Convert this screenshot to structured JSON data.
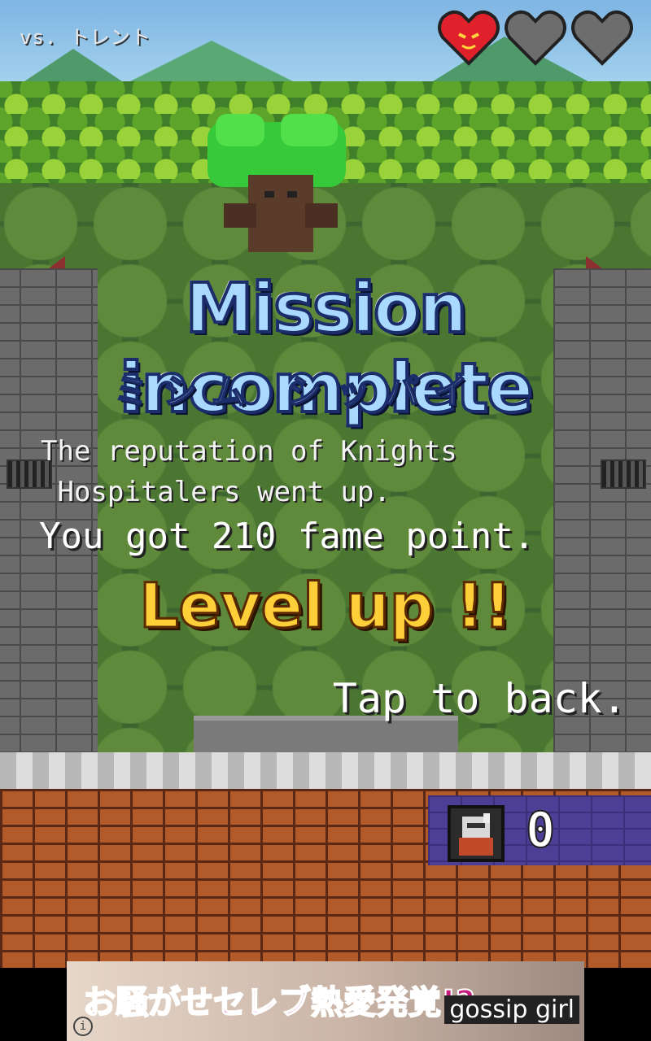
{
  "hud": {
    "opponent": "vs. トレント",
    "hearts": [
      "full-heart-icon",
      "empty-heart-icon",
      "empty-heart-icon"
    ]
  },
  "result": {
    "title": "Mission incomplete",
    "subtitle": "ミシム シッパイ",
    "message_line1": "The reputation of Knights",
    "message_line2": " Hospitalers went up.",
    "fame_message": "You got 210 fame point.",
    "levelup": "Level up !!",
    "tap_back": "Tap to back."
  },
  "counter": {
    "icon": "knight-avatar-icon",
    "value": "0"
  },
  "ad": {
    "text": "お騒がせセレブ熱愛発覚!?",
    "brand": "gossip girl",
    "info": "i"
  },
  "colors": {
    "title_fill": "#a9d9ff",
    "title_outline": "#1b2d6b",
    "levelup": "#ffcf3a",
    "heart_full": "#e0202a",
    "heart_empty": "#6d6d6d"
  }
}
